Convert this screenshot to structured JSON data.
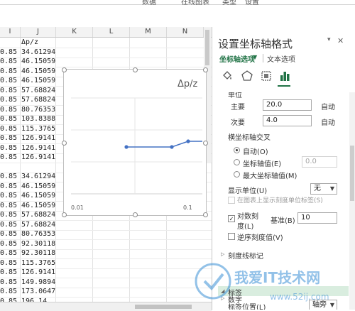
{
  "ribbon": {
    "tabs": [
      "数据",
      "在线图表",
      "类型",
      "设置"
    ]
  },
  "columns": [
    "I",
    "J",
    "K",
    "L",
    "M",
    "N"
  ],
  "rows": [
    {
      "i": "",
      "j": "Δp/z"
    },
    {
      "i": "0.85",
      "j": "34.61294"
    },
    {
      "i": "0.85",
      "j": "46.15059"
    },
    {
      "i": "0.85",
      "j": "46.15059"
    },
    {
      "i": "0.85",
      "j": "46.15059"
    },
    {
      "i": "0.85",
      "j": "57.68824"
    },
    {
      "i": "0.85",
      "j": "57.68824"
    },
    {
      "i": "0.85",
      "j": "80.76353"
    },
    {
      "i": "0.85",
      "j": "103.8388"
    },
    {
      "i": "0.85",
      "j": "115.3765"
    },
    {
      "i": "0.85",
      "j": "126.9141"
    },
    {
      "i": "0.85",
      "j": "126.9141"
    },
    {
      "i": "0.85",
      "j": "126.9141"
    },
    {
      "i": "",
      "j": ""
    },
    {
      "i": "0.85",
      "j": "34.61294"
    },
    {
      "i": "0.85",
      "j": "46.15059"
    },
    {
      "i": "0.85",
      "j": "46.15059"
    },
    {
      "i": "0.85",
      "j": "46.15059"
    },
    {
      "i": "0.85",
      "j": "57.68824"
    },
    {
      "i": "0.85",
      "j": "57.68824"
    },
    {
      "i": "0.85",
      "j": "80.76353"
    },
    {
      "i": "0.85",
      "j": "92.30118"
    },
    {
      "i": "0.85",
      "j": "92.30118"
    },
    {
      "i": "0.85",
      "j": "115.3765"
    },
    {
      "i": "0.85",
      "j": "126.9141"
    },
    {
      "i": "0.85",
      "j": "149.9894"
    },
    {
      "i": "0.85",
      "j": "173.0647"
    },
    {
      "i": "0.85",
      "j": "196.14"
    }
  ],
  "chart": {
    "title": "Δp/z",
    "x_ticks": [
      "0.01",
      "0.1"
    ],
    "line_color": "#4472c4"
  },
  "pane": {
    "title": "设置坐标轴格式",
    "tab_axis_options": "坐标轴选项",
    "tab_text_options": "文本选项",
    "icons": [
      "fill-line-icon",
      "effects-pentagon-icon",
      "size-properties-icon",
      "axis-options-bar-icon"
    ],
    "section_units_partial": "单位",
    "major_label": "主要",
    "major_value": "20.0",
    "major_auto": "自动",
    "minor_label": "次要",
    "minor_value": "4.0",
    "minor_auto": "自动",
    "crosses_label": "横坐标轴交叉",
    "crosses_auto": "自动(O)",
    "crosses_value_label": "坐标轴值(E)",
    "crosses_value": "0.0",
    "crosses_max": "最大坐标轴值(M)",
    "display_units_label": "显示单位(U)",
    "display_units_value": "无",
    "show_units_label": "在图表上显示刻度单位标签(S)",
    "log_scale_label_1": "对数刻",
    "log_scale_label_2": "度(L)",
    "log_base_label": "基准(B)",
    "log_base_value": "10",
    "reverse_label": "逆序刻度值(V)",
    "tick_marks_section": "刻度线标记",
    "labels_section": "标签",
    "label_position_label": "标签位置(L)",
    "label_position_value": "轴旁",
    "number_section": "数字",
    "accent_color": "#217346"
  },
  "watermark": {
    "brand": "我爱IT技术网",
    "url": "www.52ij.com"
  }
}
